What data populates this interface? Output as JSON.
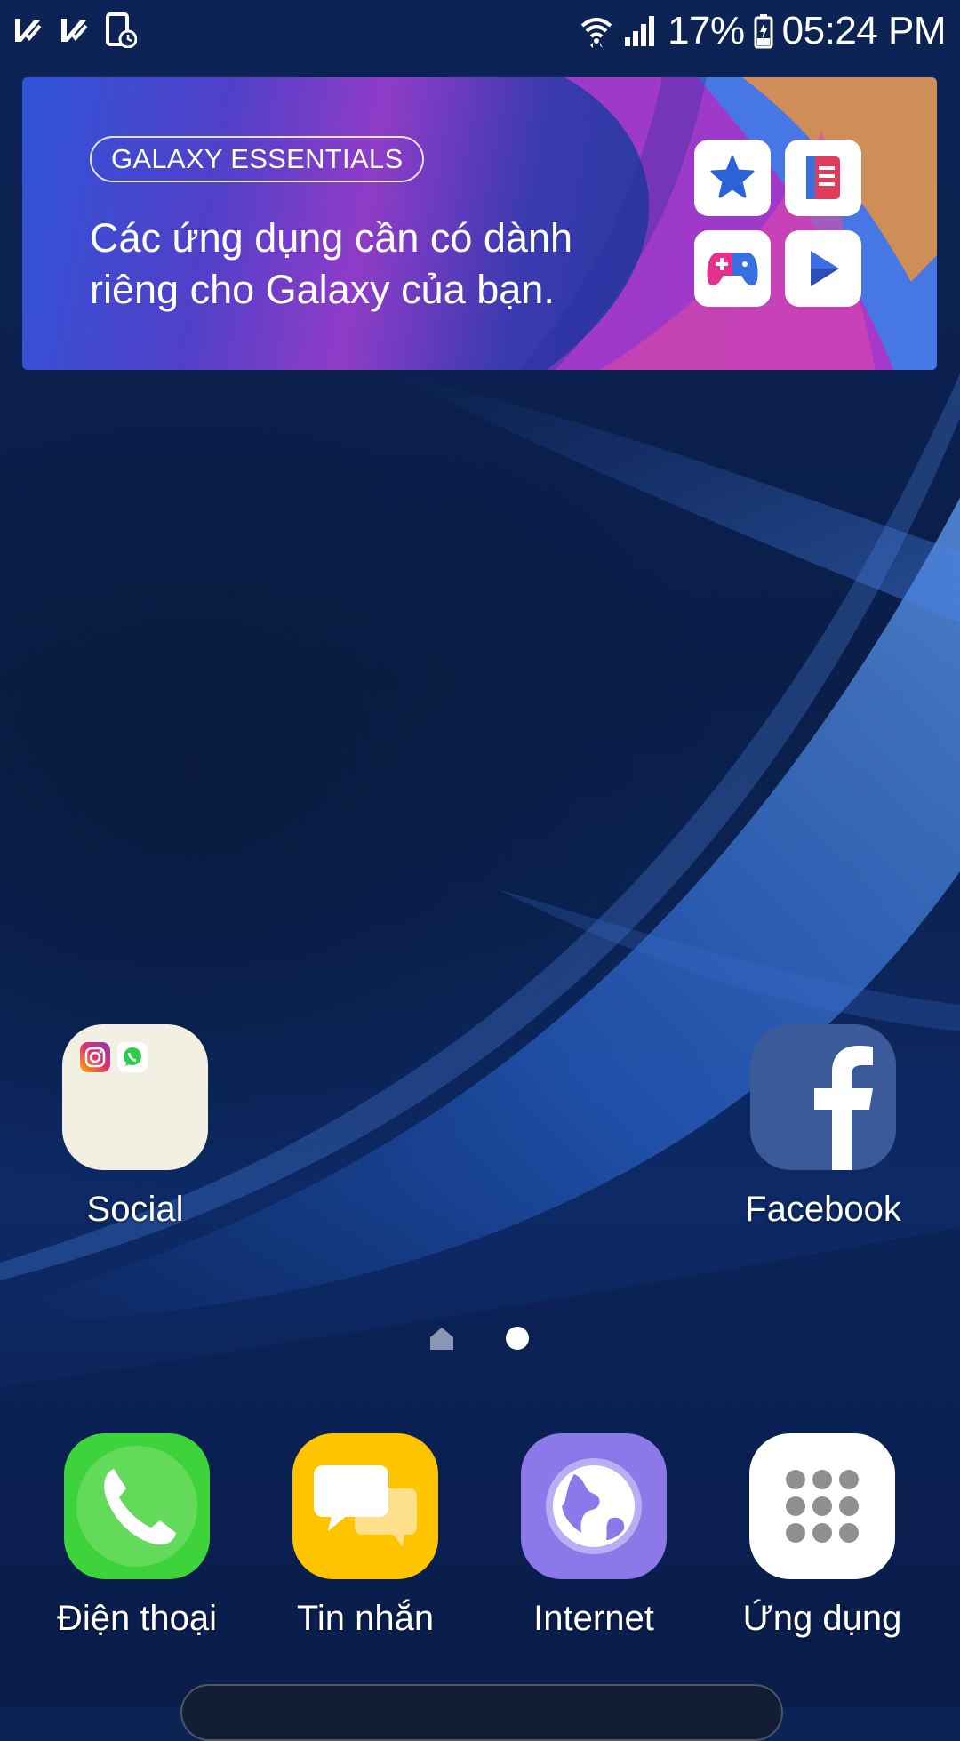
{
  "status_bar": {
    "battery": "17%",
    "time": "05:24 PM",
    "left_icons": [
      "check-notification-icon",
      "check-notification-icon",
      "screen-timer-icon"
    ],
    "right_icons": [
      "wifi-icon",
      "signal-icon",
      "battery-charging-icon"
    ]
  },
  "widget": {
    "badge": "GALAXY ESSENTIALS",
    "text": "Các ứng dụng cần có dành riêng cho Galaxy của bạn.",
    "tiles": [
      "star-icon",
      "book-icon",
      "gamepad-icon",
      "play-icon"
    ]
  },
  "home": {
    "folder": {
      "label": "Social",
      "contents": [
        "instagram-icon",
        "whatsapp-icon"
      ]
    },
    "facebook": {
      "label": "Facebook"
    }
  },
  "page_indicator": {
    "pages": [
      "home",
      "dot"
    ],
    "active_index": 1
  },
  "dock": {
    "phone": {
      "label": "Điện thoại",
      "color": "#3fcf3a"
    },
    "messages": {
      "label": "Tin nhắn",
      "color": "#ffc400"
    },
    "internet": {
      "label": "Internet",
      "color": "#8c78e8"
    },
    "apps": {
      "label": "Ứng dụng",
      "color": "#ffffff"
    }
  }
}
